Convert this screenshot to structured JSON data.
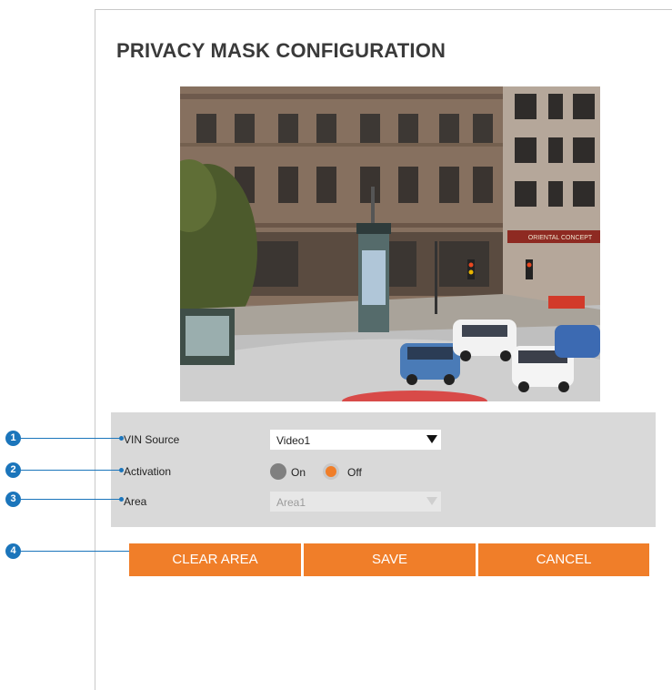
{
  "page": {
    "title": "PRIVACY MASK CONFIGURATION"
  },
  "preview": {
    "sign_text": "ORIENTAL CONCEPT"
  },
  "form": {
    "vin_source": {
      "label": "VIN Source",
      "value": "Video1"
    },
    "activation": {
      "label": "Activation",
      "options": [
        {
          "label": "On",
          "selected": false
        },
        {
          "label": "Off",
          "selected": true
        }
      ]
    },
    "area": {
      "label": "Area",
      "value": "Area1",
      "disabled": true
    }
  },
  "buttons": {
    "clear_area": "CLEAR AREA",
    "save": "SAVE",
    "cancel": "CANCEL"
  },
  "callouts": [
    "1",
    "2",
    "3",
    "4"
  ],
  "colors": {
    "accent": "#f07e29",
    "callout": "#1b75bb",
    "panel": "#d9d9d9"
  }
}
